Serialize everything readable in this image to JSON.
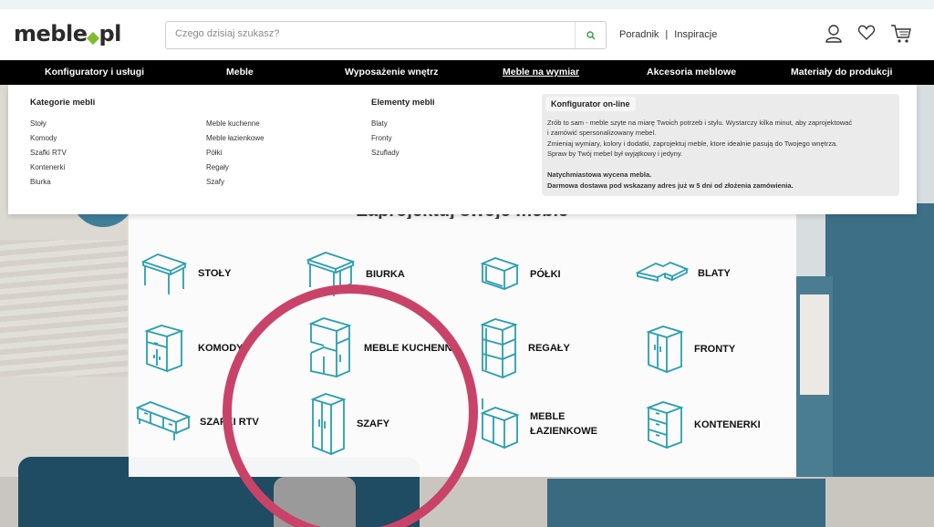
{
  "header": {
    "logo": {
      "before": "meble",
      "after": "pl"
    },
    "search_placeholder": "Czego dzisiaj szukasz?",
    "links": [
      "Poradnik",
      "Inspiracje"
    ],
    "separator": "|"
  },
  "nav": {
    "items": [
      "Konfiguratory i usługi",
      "Meble",
      "Wyposażenie wnętrz",
      "Meble na wymiar",
      "Akcesoria meblowe",
      "Materiały do produkcji"
    ],
    "active": "Meble na wymiar"
  },
  "mega_menu": {
    "categories_heading": "Kategorie mebli",
    "categories_col1": [
      "Stoły",
      "Komody",
      "Szafki RTV",
      "Kontenerki",
      "Biurka"
    ],
    "categories_col2": [
      "Meble kuchenne",
      "Meble łazienkowe",
      "Półki",
      "Regały",
      "Szafy"
    ],
    "elements_heading": "Elementy mebli",
    "elements": [
      "Blaty",
      "Fronty",
      "Szuflady"
    ],
    "promo": {
      "title": "Konfigurator on-line",
      "lines": [
        "Zrób to sam - meble szyte na miarę Twoich potrzeb i stylu. Wystarczy kilka minut, aby zaprojektować",
        "i zamówić spersonalizowany mebel.",
        "Zmieniaj wymiary, kolory i dodatki, zaprojektuj meble, ktore idealnie pasują do Twojego wnętrza.",
        "Spraw by Twój mebel był wyjątkowy i jedyny."
      ],
      "bold_lines": [
        "Natychmiastowa wycena mebla.",
        "Darmowa dostawa pod wskazany adres już w 5 dni od złożenia zamówienia."
      ]
    }
  },
  "panel": {
    "title": "Zaprojektuj swoje meble",
    "tiles": [
      {
        "label": "STOŁY",
        "icon": "table-icon"
      },
      {
        "label": "BIURKA",
        "icon": "desk-icon"
      },
      {
        "label": "PÓŁKI",
        "icon": "shelf-icon"
      },
      {
        "label": "BLATY",
        "icon": "countertop-icon"
      },
      {
        "label": "KOMODY",
        "icon": "dresser-icon"
      },
      {
        "label": "MEBLE KUCHENNE",
        "icon": "kitchen-cabinet-icon"
      },
      {
        "label": "REGAŁY",
        "icon": "bookcase-icon"
      },
      {
        "label": "FRONTY",
        "icon": "cabinet-front-icon"
      },
      {
        "label": "SZAFKI RTV",
        "icon": "tv-stand-icon"
      },
      {
        "label": "SZAFY",
        "icon": "wardrobe-icon"
      },
      {
        "label": "MEBLE\nŁAZIENKOWE",
        "label_line1": "MEBLE",
        "label_line2": "ŁAZIENKOWE",
        "icon": "bathroom-cabinet-icon"
      },
      {
        "label": "KONTENERKI",
        "icon": "drawer-unit-icon"
      }
    ]
  },
  "colors": {
    "nav_bg": "#000000",
    "logo_accent": "#7dbd2c",
    "icon_stroke": "#2a9fb0",
    "highlight_ring": "#c94368",
    "search_icon": "#3aa14a"
  }
}
